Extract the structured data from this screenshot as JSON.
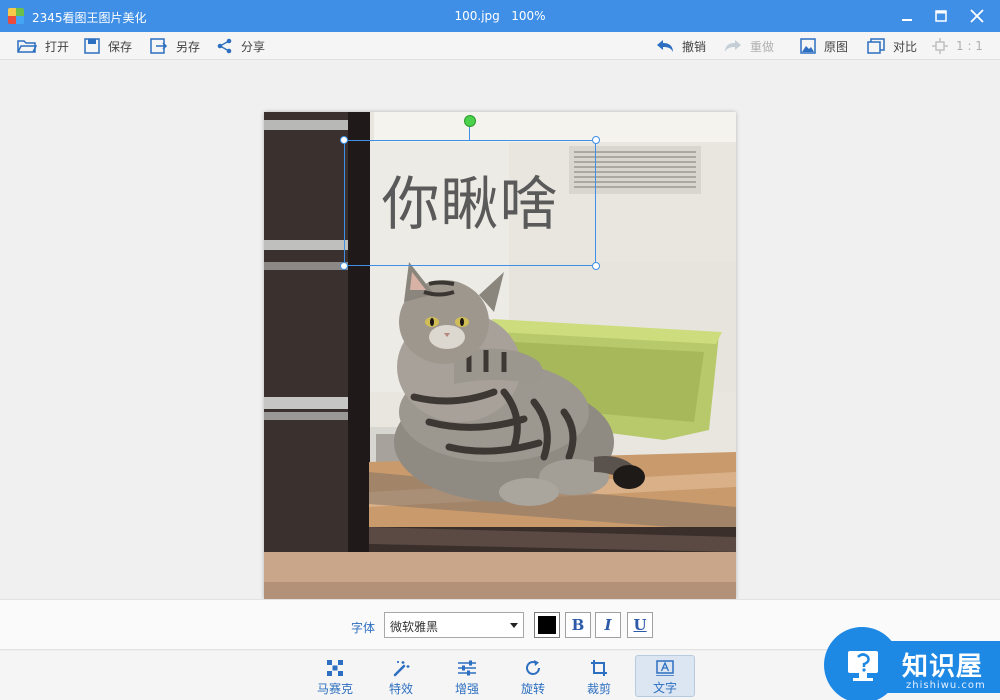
{
  "titlebar": {
    "app_name": "2345看图王图片美化",
    "file_name": "100.jpg",
    "zoom": "100%"
  },
  "toolbar": {
    "left": [
      {
        "label": "打开",
        "icon": "folder-open-icon"
      },
      {
        "label": "保存",
        "icon": "floppy-disk-icon"
      },
      {
        "label": "另存",
        "icon": "save-as-icon"
      },
      {
        "label": "分享",
        "icon": "share-icon"
      }
    ],
    "right": [
      {
        "label": "撤销",
        "icon": "undo-icon",
        "enabled": true
      },
      {
        "label": "重做",
        "icon": "redo-icon",
        "enabled": false
      },
      {
        "label": "原图",
        "icon": "image-icon",
        "enabled": true
      },
      {
        "label": "对比",
        "icon": "compare-icon",
        "enabled": true
      },
      {
        "label": "1 : 1",
        "icon": "actual-size-icon",
        "enabled": false
      }
    ]
  },
  "canvas": {
    "overlay_text": "你瞅啥"
  },
  "font_options": {
    "label": "字体",
    "font_family": "微软雅黑",
    "color": "#000000",
    "bold_label": "B",
    "italic_label": "I",
    "underline_label": "U"
  },
  "bottom_tools": [
    {
      "label": "马赛克",
      "icon": "mosaic-icon",
      "active": false
    },
    {
      "label": "特效",
      "icon": "magic-wand-icon",
      "active": false
    },
    {
      "label": "增强",
      "icon": "sliders-icon",
      "active": false
    },
    {
      "label": "旋转",
      "icon": "rotate-icon",
      "active": false
    },
    {
      "label": "裁剪",
      "icon": "crop-icon",
      "active": false
    },
    {
      "label": "文字",
      "icon": "text-icon",
      "active": true
    }
  ],
  "watermark": {
    "title": "知识屋",
    "subtitle": "zhishiwu.com"
  },
  "colors": {
    "titlebar": "#3f8fe6",
    "accent": "#2d6fc0",
    "selection": "#3f8fe6",
    "rotate_handle": "#4bd14b"
  }
}
